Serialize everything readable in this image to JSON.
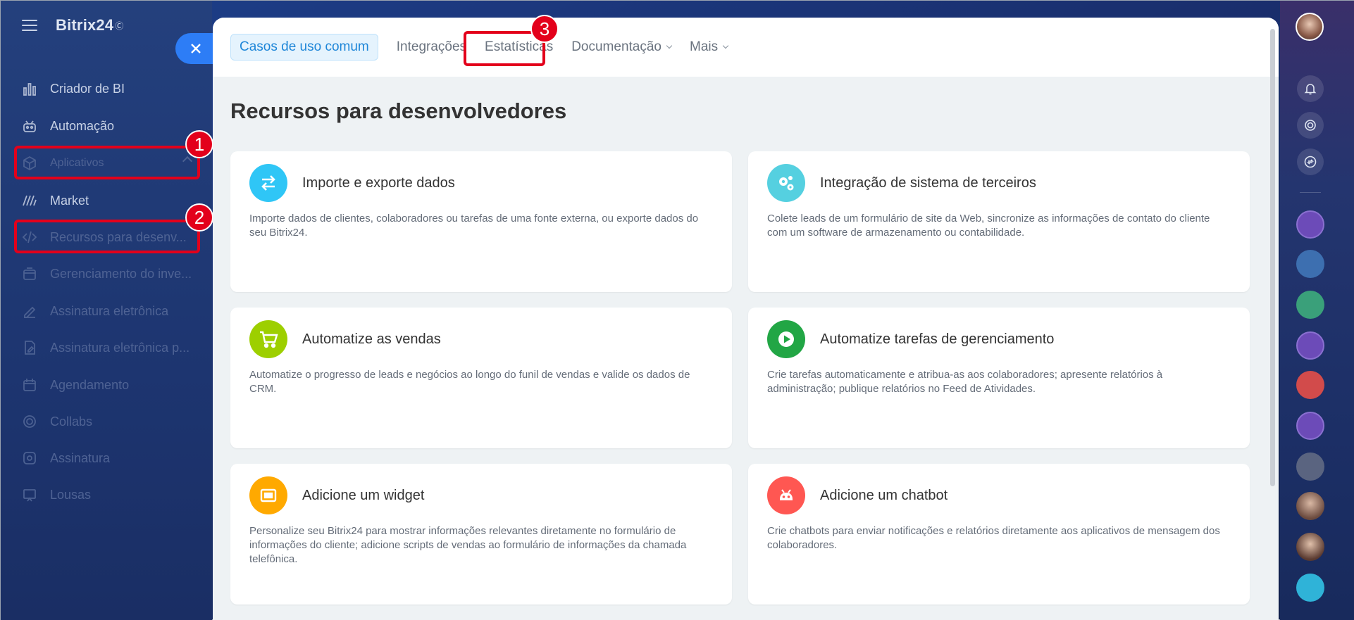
{
  "app": {
    "logo": "Bitrix24",
    "logo_mark": "Ⓞ"
  },
  "sidebar": {
    "items": [
      {
        "label": "Criador de BI",
        "icon": "bar-chart-icon",
        "state": "bright"
      },
      {
        "label": "Automação",
        "icon": "robot-icon",
        "state": "bright"
      },
      {
        "label": "Aplicativos",
        "icon": "cube-icon",
        "state": "dim"
      },
      {
        "label": "Market",
        "icon": "market-icon",
        "state": "bright"
      },
      {
        "label": "Recursos para desenv...",
        "icon": "code-icon",
        "state": "dim"
      },
      {
        "label": "Gerenciamento do inve...",
        "icon": "inventory-icon",
        "state": "dim"
      },
      {
        "label": "Assinatura eletrônica",
        "icon": "signature-icon",
        "state": "dim"
      },
      {
        "label": "Assinatura eletrônica p...",
        "icon": "signature-doc-icon",
        "state": "dim"
      },
      {
        "label": "Agendamento",
        "icon": "calendar-icon",
        "state": "dim"
      },
      {
        "label": "Collabs",
        "icon": "collabs-icon",
        "state": "dim"
      },
      {
        "label": "Assinatura",
        "icon": "subscription-icon",
        "state": "dim"
      },
      {
        "label": "Lousas",
        "icon": "board-icon",
        "state": "dim"
      }
    ]
  },
  "annotations": {
    "badge1": "1",
    "badge2": "2",
    "badge3": "3",
    "highlight_color": "#e3001b"
  },
  "topnav": {
    "tabs": [
      {
        "label": "Casos de uso comum",
        "active": true
      },
      {
        "label": "Integrações"
      },
      {
        "label": "Estatísticas"
      },
      {
        "label": "Documentação",
        "dropdown": true
      },
      {
        "label": "Mais",
        "dropdown": true
      }
    ]
  },
  "main": {
    "title": "Recursos para desenvolvedores",
    "cards": [
      {
        "title": "Importe e exporte dados",
        "desc": "Importe dados de clientes, colaboradores ou tarefas de uma fonte externa, ou exporte dados do seu Bitrix24.",
        "icon": "arrows-exchange-icon",
        "color": "#2fc6f6"
      },
      {
        "title": "Integração de sistema de terceiros",
        "desc": "Colete leads de um formulário de site da Web, sincronize as informações de contato do cliente com um software de armazenamento ou contabilidade.",
        "icon": "gears-icon",
        "color": "#55d0e0"
      },
      {
        "title": "Automatize as vendas",
        "desc": "Automatize o progresso de leads e negócios ao longo do funil de vendas e valide os dados de CRM.",
        "icon": "cart-icon",
        "color": "#9dcf00"
      },
      {
        "title": "Automatize tarefas de gerenciamento",
        "desc": "Crie tarefas automaticamente e atribua-as aos colaboradores; apresente relatórios à administração; publique relatórios no Feed de Atividades.",
        "icon": "play-icon",
        "color": "#22a645"
      },
      {
        "title": "Adicione um widget",
        "desc": "Personalize seu Bitrix24 para mostrar informações relevantes diretamente no formulário de informações do cliente; adicione scripts de vendas ao formulário de informações da chamada telefônica.",
        "icon": "widget-icon",
        "color": "#ffa900"
      },
      {
        "title": "Adicione um chatbot",
        "desc": "Crie chatbots para enviar notificações e relatórios diretamente aos aplicativos de mensagem dos colaboradores.",
        "icon": "bot-icon",
        "color": "#ff5752"
      }
    ]
  }
}
